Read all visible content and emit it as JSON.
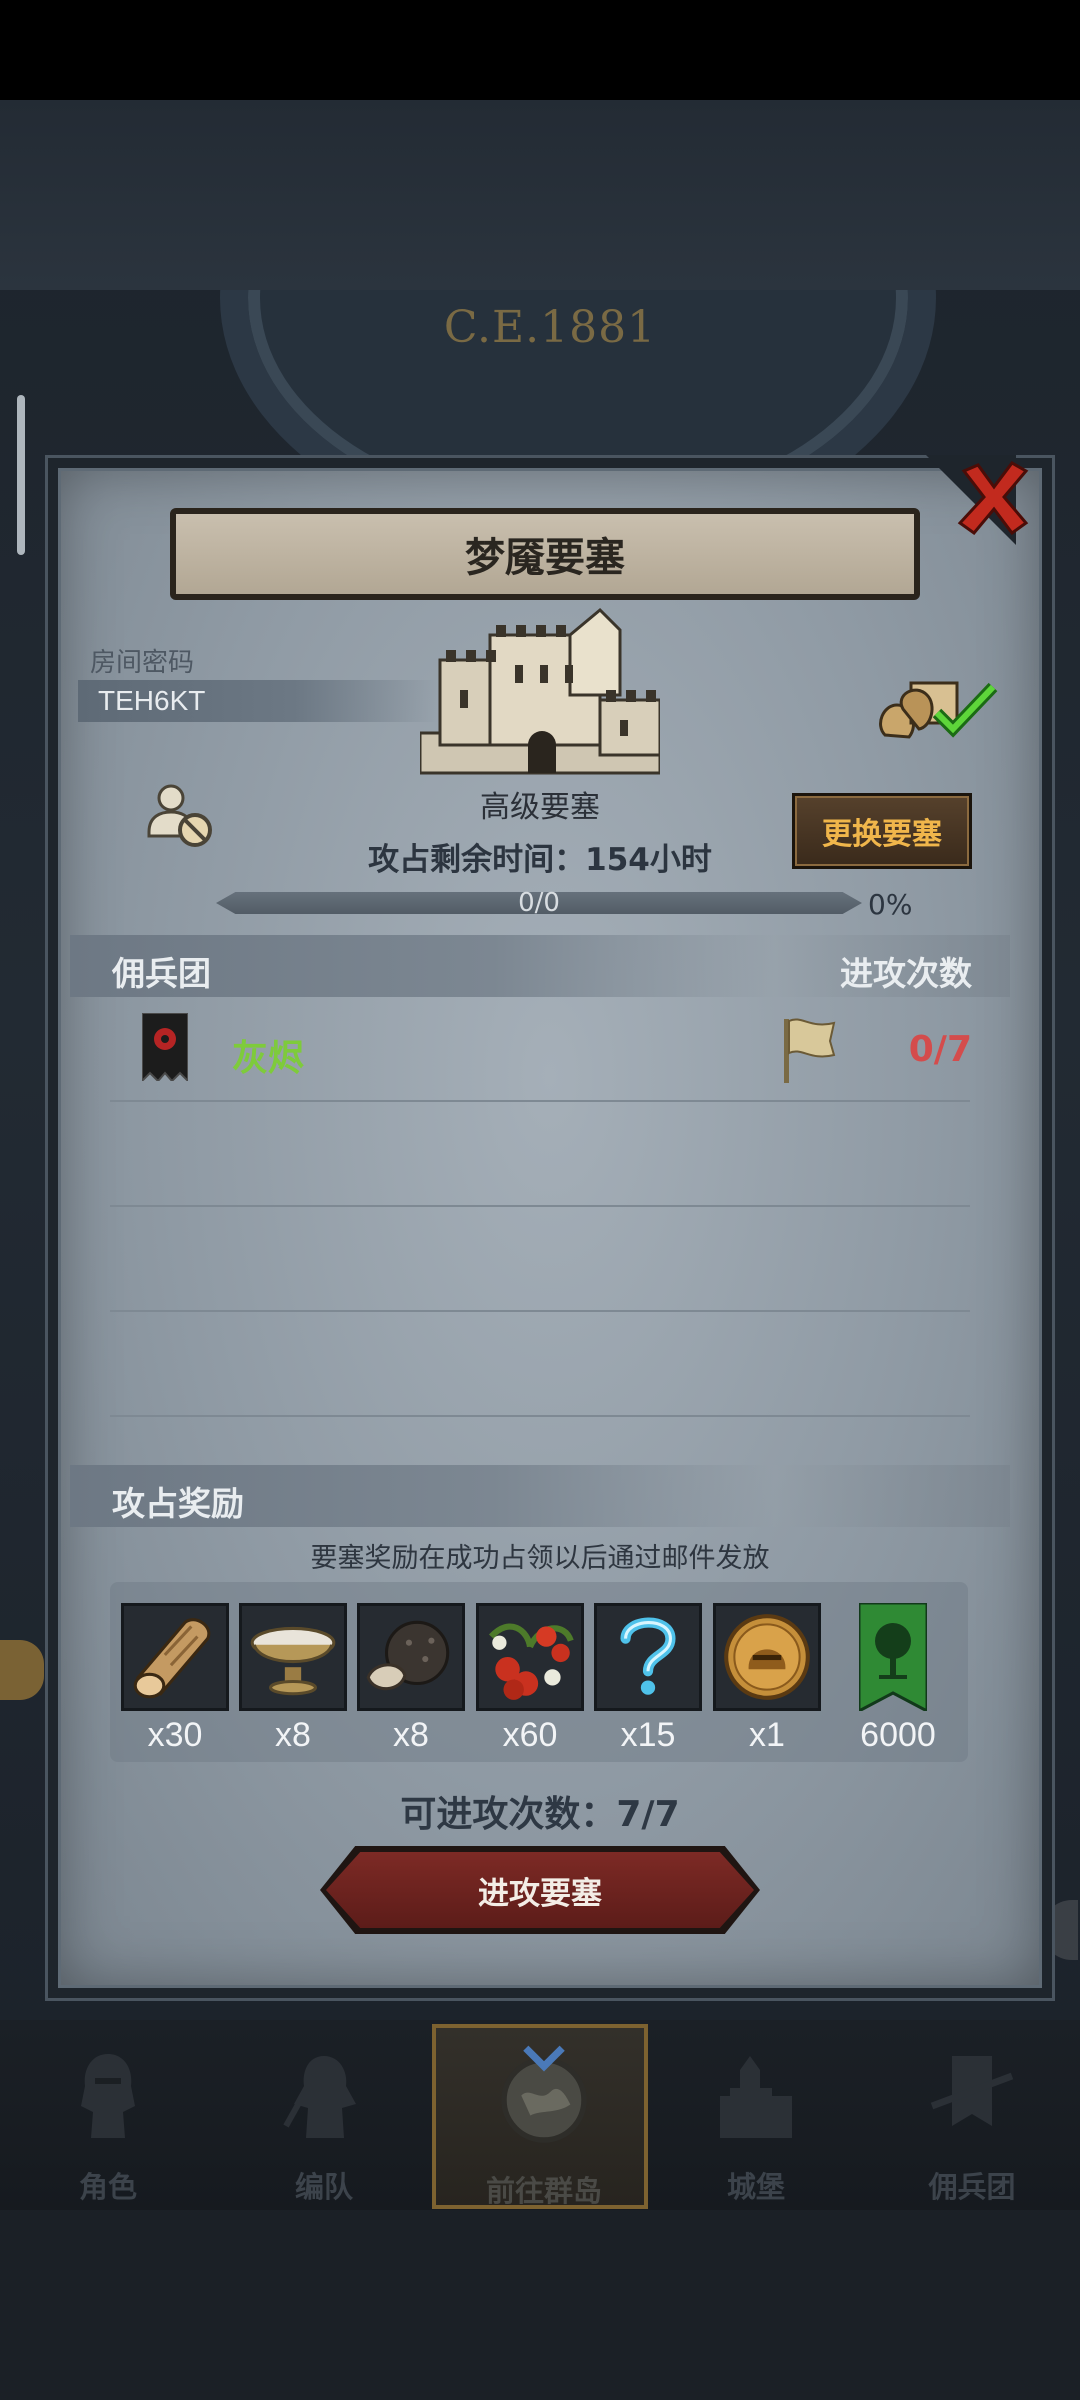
{
  "background": {
    "year": "C.E.1881"
  },
  "dialog": {
    "title": "梦魇要塞",
    "room_code_label": "房间密码",
    "room_code": "TEH6KT",
    "fort_name": "高级要塞",
    "change_button": "更换要塞",
    "timer_text": "攻占剩余时间：154小时",
    "progress": {
      "text": "0/0",
      "percent_label": "0%",
      "fraction": 0
    },
    "mercenary_header": "佣兵团",
    "attack_count_header": "进攻次数",
    "guild": {
      "name": "灰烬",
      "attacks": "0/7"
    },
    "rewards_header": "攻占奖励",
    "rewards_note": "要塞奖励在成功占领以后通过邮件发放",
    "rewards": [
      {
        "icon": "wood-log-icon",
        "qty": "x30"
      },
      {
        "icon": "bowl-icon",
        "qty": "x8"
      },
      {
        "icon": "truffle-icon",
        "qty": "x8"
      },
      {
        "icon": "berries-icon",
        "qty": "x60"
      },
      {
        "icon": "mystery-icon",
        "qty": "x15"
      },
      {
        "icon": "helmet-coin-icon",
        "qty": "x1"
      },
      {
        "icon": "tree-banner-icon",
        "qty": "6000"
      }
    ],
    "attacks_available": "可进攻次数：7/7",
    "attack_button": "进攻要塞"
  },
  "navbar": {
    "items": [
      {
        "label": "角色",
        "icon": "knight-icon"
      },
      {
        "label": "编队",
        "icon": "squad-icon"
      },
      {
        "label": "前往群岛",
        "icon": "globe-icon",
        "active": true
      },
      {
        "label": "城堡",
        "icon": "castle-icon"
      },
      {
        "label": "佣兵团",
        "icon": "mercenary-icon"
      }
    ]
  },
  "colors": {
    "panel": "#98a3ad",
    "guild_name": "#7ecb3b",
    "attack_count": "#d44c4c",
    "change_button_text": "#f0b64b",
    "attack_button": "#6e2420"
  }
}
